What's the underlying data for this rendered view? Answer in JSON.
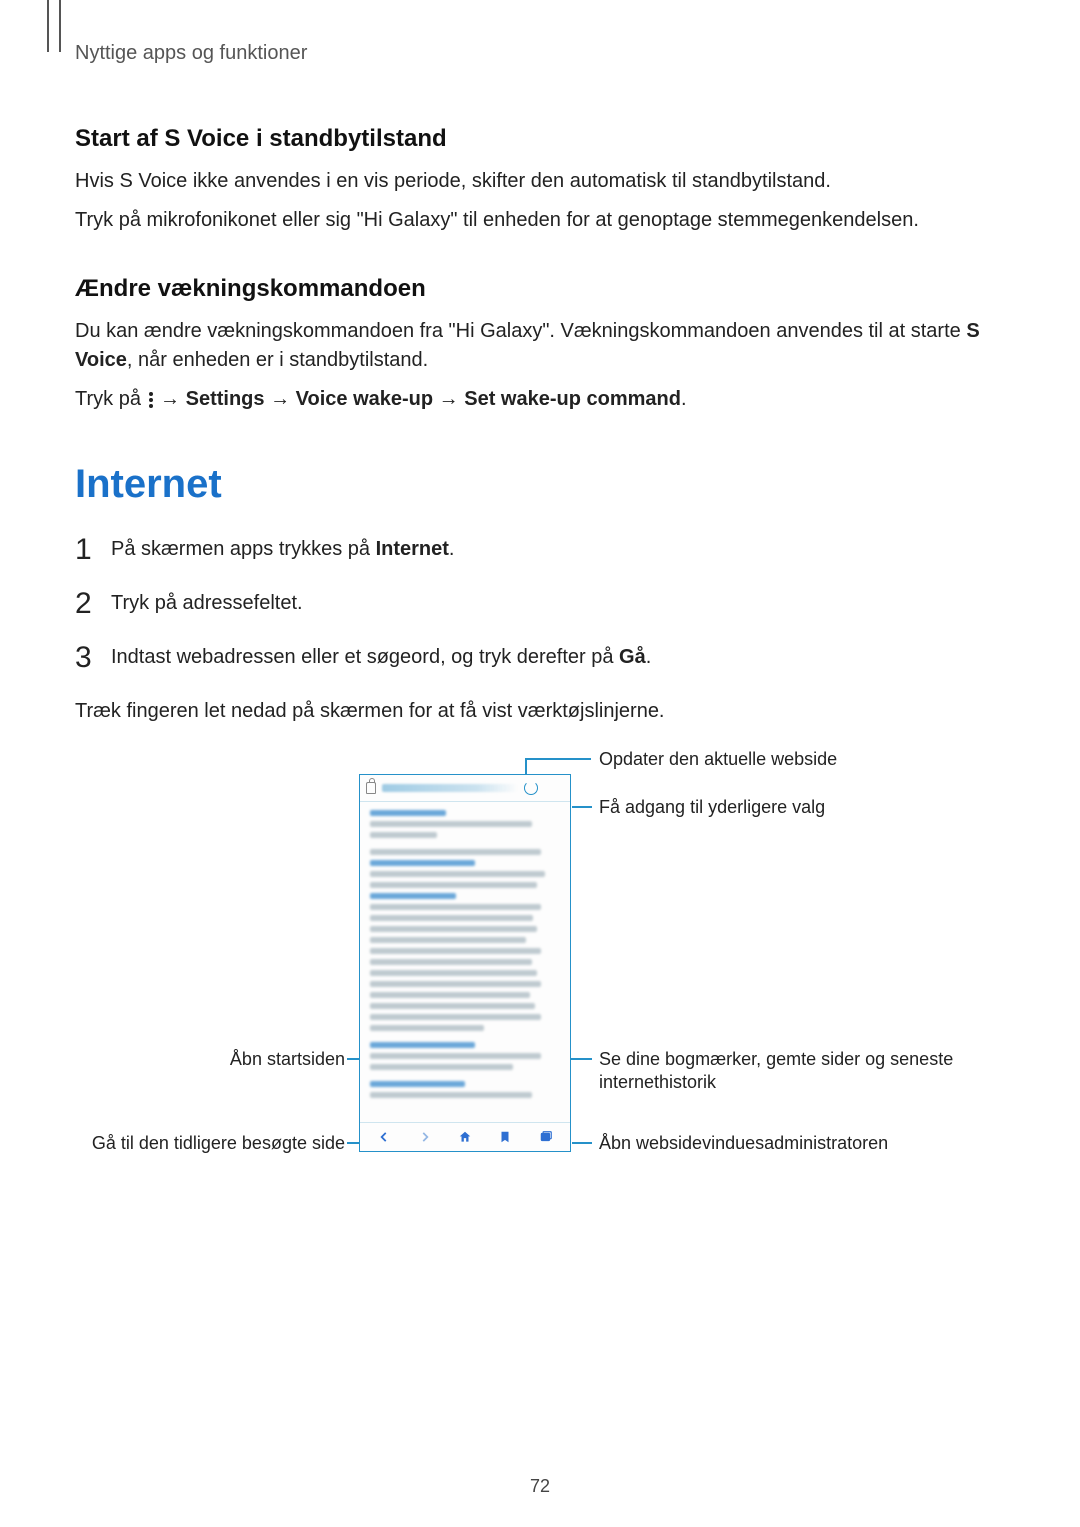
{
  "breadcrumb": "Nyttige apps og funktioner",
  "svoiceStandby": {
    "heading": "Start af S Voice i standbytilstand",
    "p1": "Hvis S Voice ikke anvendes i en vis periode, skifter den automatisk til standbytilstand.",
    "p2": "Tryk på mikrofonikonet eller sig \"Hi Galaxy\" til enheden for at genoptage stemmegenkendelsen."
  },
  "wakeCmd": {
    "heading": "Ændre vækningskommandoen",
    "p1_a": "Du kan ændre vækningskommandoen fra \"Hi Galaxy\". Vækningskommandoen anvendes til at starte ",
    "p1_b": "S Voice",
    "p1_c": ", når enheden er i standbytilstand.",
    "p2_a": "Tryk på ",
    "p2_arrow": " → ",
    "p2_b": "Settings",
    "p2_c": "Voice wake-up",
    "p2_d": "Set wake-up command",
    "p2_period": "."
  },
  "internet": {
    "heading": "Internet",
    "step1_a": "På skærmen apps trykkes på ",
    "step1_b": "Internet",
    "step1_c": ".",
    "step2": "Tryk på adressefeltet.",
    "step3_a": "Indtast webadressen eller et søgeord, og tryk derefter på ",
    "step3_b": "Gå",
    "step3_c": ".",
    "after": "Træk fingeren let nedad på skærmen for at få vist værktøjslinjerne."
  },
  "callouts": {
    "r1": "Opdater den aktuelle webside",
    "r2": "Få adgang til yderligere valg",
    "r3": "Se dine bogmærker, gemte sider og seneste internethistorik",
    "r4": "Åbn websidevinduesadministratoren",
    "l1": "Åbn startsiden",
    "l2": "Gå til den tidligere besøgte side"
  },
  "pageNumber": "72"
}
